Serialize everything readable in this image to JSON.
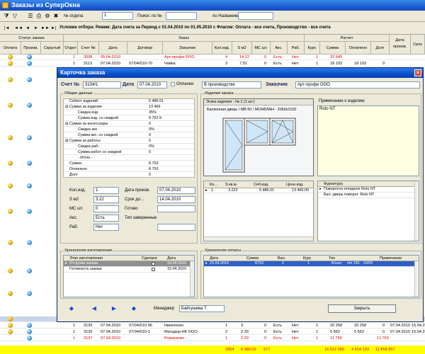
{
  "app": {
    "title": "Заказы из СуперОкна"
  },
  "toolbar": {
    "otdel_label": "№ отдела",
    "otdel_value": "1",
    "search_label": "Поиск: по №",
    "search_value": "",
    "name_label": "по Названию",
    "name_value": ""
  },
  "filter": {
    "text": "Условие отбора: Режим: Дата счета за Период с 01.04.2010 по 01.05.2010 с Флагом: Оплата - все счета, Производство - все счета"
  },
  "grid": {
    "group_status": "Статус заказа",
    "group_order": "Заказ",
    "group_calc": "Расчет",
    "headers": [
      "Оплата",
      "Произв.",
      "Скрытый",
      "Отдел",
      "Счет №",
      "Дата",
      "Договор",
      "Заказчик",
      "Кол.изд.",
      "S м2",
      "МС шт.",
      "Акс.",
      "Раб.",
      "Курс",
      "Сумма",
      "Оплачено",
      "Долг",
      "Дата произв.",
      "Срок"
    ],
    "top_rows": [
      {
        "otdel": "1",
        "schet": "3098",
        "date": "05.04.2010",
        "dogovor": "",
        "client": "Арт-профи ООО",
        "qty": "4",
        "s": "14.12",
        "ms": "0",
        "aks": "Есть",
        "rab": "Нет",
        "kurs": "1",
        "summa": "32 645",
        "opl": "",
        "dolg": "",
        "red": true
      },
      {
        "otdel": "1",
        "schet": "3113",
        "date": "07.04.2010",
        "dogovor": "07/04/010-70",
        "client": "Чайка",
        "qty": "3",
        "s": "7.91",
        "ms": "0",
        "aks": "Есть",
        "rab": "Нет",
        "kurs": "1",
        "summa": "18 193",
        "opl": "18 193",
        "dolg": "0",
        "red": false
      }
    ],
    "bottom_rows": [
      {
        "otdel": "1",
        "schet": "3135",
        "date": "07.04.2010",
        "dogovor": "07/04/010-96",
        "client": "Никитенко",
        "qty": "1",
        "s": "3",
        "ms": "0",
        "aks": "Есть",
        "rab": "Нет",
        "kurs": "1",
        "summa": "20 258",
        "opl": "20 258",
        "dolg": "0",
        "dpr": "07.04.2010",
        "srok": "15.04.2010",
        "red": false
      },
      {
        "otdel": "1",
        "schet": "3136",
        "date": "07.04.2010",
        "dogovor": "07/04/010-1",
        "client": "Матадор-НК ООО",
        "qty": "2",
        "s": "2.33",
        "ms": "0",
        "aks": "Есть",
        "rab": "Нет",
        "kurs": "1",
        "summa": "5 562",
        "opl": "5 562",
        "dolg": "0",
        "dpr": "07.04.2010",
        "srok": "15.04.2010",
        "red": false
      },
      {
        "otdel": "1",
        "schet": "3137",
        "date": "07.04.2010",
        "dogovor": "",
        "client": "Романенко",
        "qty": "1",
        "s": "3.29",
        "ms": "0",
        "aks": "Есть",
        "rab": "Нет",
        "kurs": "1",
        "summa": "11 769",
        "opl": "",
        "dolg": "11 769",
        "dpr": "",
        "srok": "",
        "red": true
      }
    ],
    "totals": {
      "qty": "2954",
      "s": "6 389.02",
      "ms": "577",
      "summa": "16 512 990",
      "opl": "4 654 133",
      "dolg": "11 858 857"
    }
  },
  "dialog": {
    "title": "Карточка заказа",
    "schet_label": "Счет №",
    "schet_value": "3134/1",
    "date_label": "Дата",
    "date_value": "07.04.2010",
    "paid_label": "Оплачен",
    "prod_value": "В производстве",
    "client_label": "Заказчик",
    "client_value": "Арт-профи ООО",
    "general": {
      "title": "Общие данные",
      "rows": [
        {
          "k": "Себест изделий",
          "v": "6 486.01"
        },
        {
          "k": "⊟ Сумма за изделия",
          "v": "13 466"
        },
        {
          "k": "Скидка изд.",
          "v": "35%"
        },
        {
          "k": "Сумма изд. со скидкой",
          "v": "8 752.9"
        },
        {
          "k": "⊟ Сумма за аксессуары",
          "v": "0"
        },
        {
          "k": "Скидка акс.",
          "v": "0%"
        },
        {
          "k": "Сумма акс. со скидкой",
          "v": "0"
        },
        {
          "k": "⊟ Сумма за работы",
          "v": "0"
        },
        {
          "k": "Скидка раб.",
          "v": "0%"
        },
        {
          "k": "Сумма работ со скидкой",
          "v": "0"
        },
        {
          "k": "- Итого -",
          "v": ""
        },
        {
          "k": "Сумма",
          "v": "8 753"
        },
        {
          "k": "Оплачено",
          "v": "8 753"
        },
        {
          "k": "Долг",
          "v": "0"
        }
      ],
      "qty_label": "Кол.изд.",
      "qty_value": "1",
      "s_label": "S м2",
      "s_value": "3.22",
      "ms_label": "МС шт.",
      "ms_value": "0",
      "aks_label": "Акс.",
      "aks_value": "Есть",
      "rab_label": "Раб.",
      "rab_value": "Нет",
      "dpr_label": "Дата произв.",
      "dpr_value": "07.04.2010",
      "srok_label": "Срок до...",
      "srok_value": "14.04.2010",
      "ready_label": "Готово",
      "pay_type_label": "Тип заверенные"
    },
    "items": {
      "title": "Изделия заказа",
      "sketch_label": "Эскиз изделия - № 1 (1 шт.)",
      "sketch_desc": "Балконная дверь \\ МВ 60 \\ МОНБЛАН - 2060х2100",
      "note_label": "Примечание к изделию",
      "note_value": "Roto NT",
      "headers": [
        "Ко...",
        "S кв.м.",
        "Себ.изд.",
        "Цена изд."
      ],
      "rows": [
        {
          "ko": "1",
          "s": "3.222",
          "seb": "6 486.01",
          "price": "13 466.00"
        }
      ],
      "fittings_header": "Фурнитура",
      "fittings": [
        "Поворотно-откидное Roto NT",
        "Бал. дверь поворот. Roto NT"
      ]
    },
    "history": {
      "title": "Хронология изготовления",
      "headers": [
        "Этап изготовления",
        "Сделано",
        "Дата"
      ],
      "rows": [
        {
          "stage": "Отгрузка заказа",
          "date": "15.04.2010",
          "selected": true
        },
        {
          "stage": "Готовность заказа",
          "date": "15.04.2010",
          "selected": false
        }
      ]
    },
    "payments": {
      "title": "Хронология оплаты",
      "headers": [
        "Дата",
        "Сумма",
        "Вал.",
        "Курс",
        "Тип",
        "Примечание"
      ],
      "rows": [
        {
          "date": "15.04.2010",
          "sum": "8753",
          "val": "1",
          "kurs": "1",
          "type": "Б/нал",
          "note": "п/п 241 - 100%"
        }
      ]
    },
    "manager_label": "Менеджер",
    "manager_value": "Байгушева Т.",
    "close_label": "Закрыть"
  }
}
